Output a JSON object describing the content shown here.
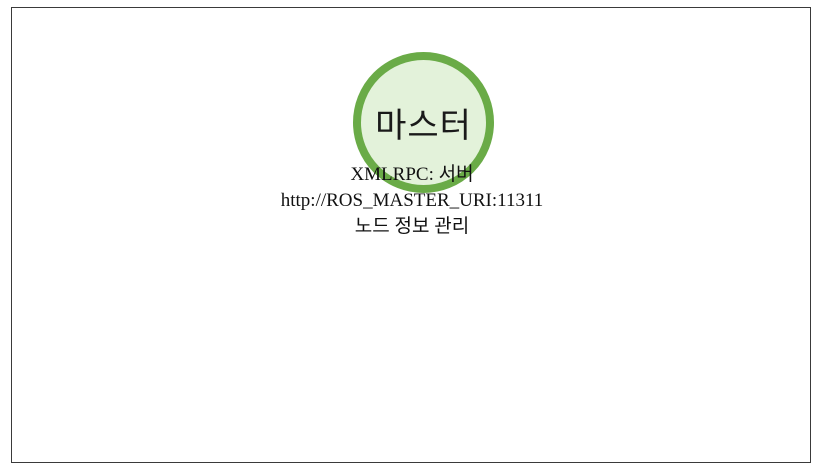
{
  "diagram": {
    "master": {
      "label": "마스터"
    },
    "info_lines": [
      "XMLRPC: 서버",
      "http://ROS_MASTER_URI:11311",
      "노드 정보 관리"
    ]
  },
  "colors": {
    "node_border": "#6aab47",
    "node_fill": "#e3f2da",
    "frame_border": "#3a3a3a"
  }
}
